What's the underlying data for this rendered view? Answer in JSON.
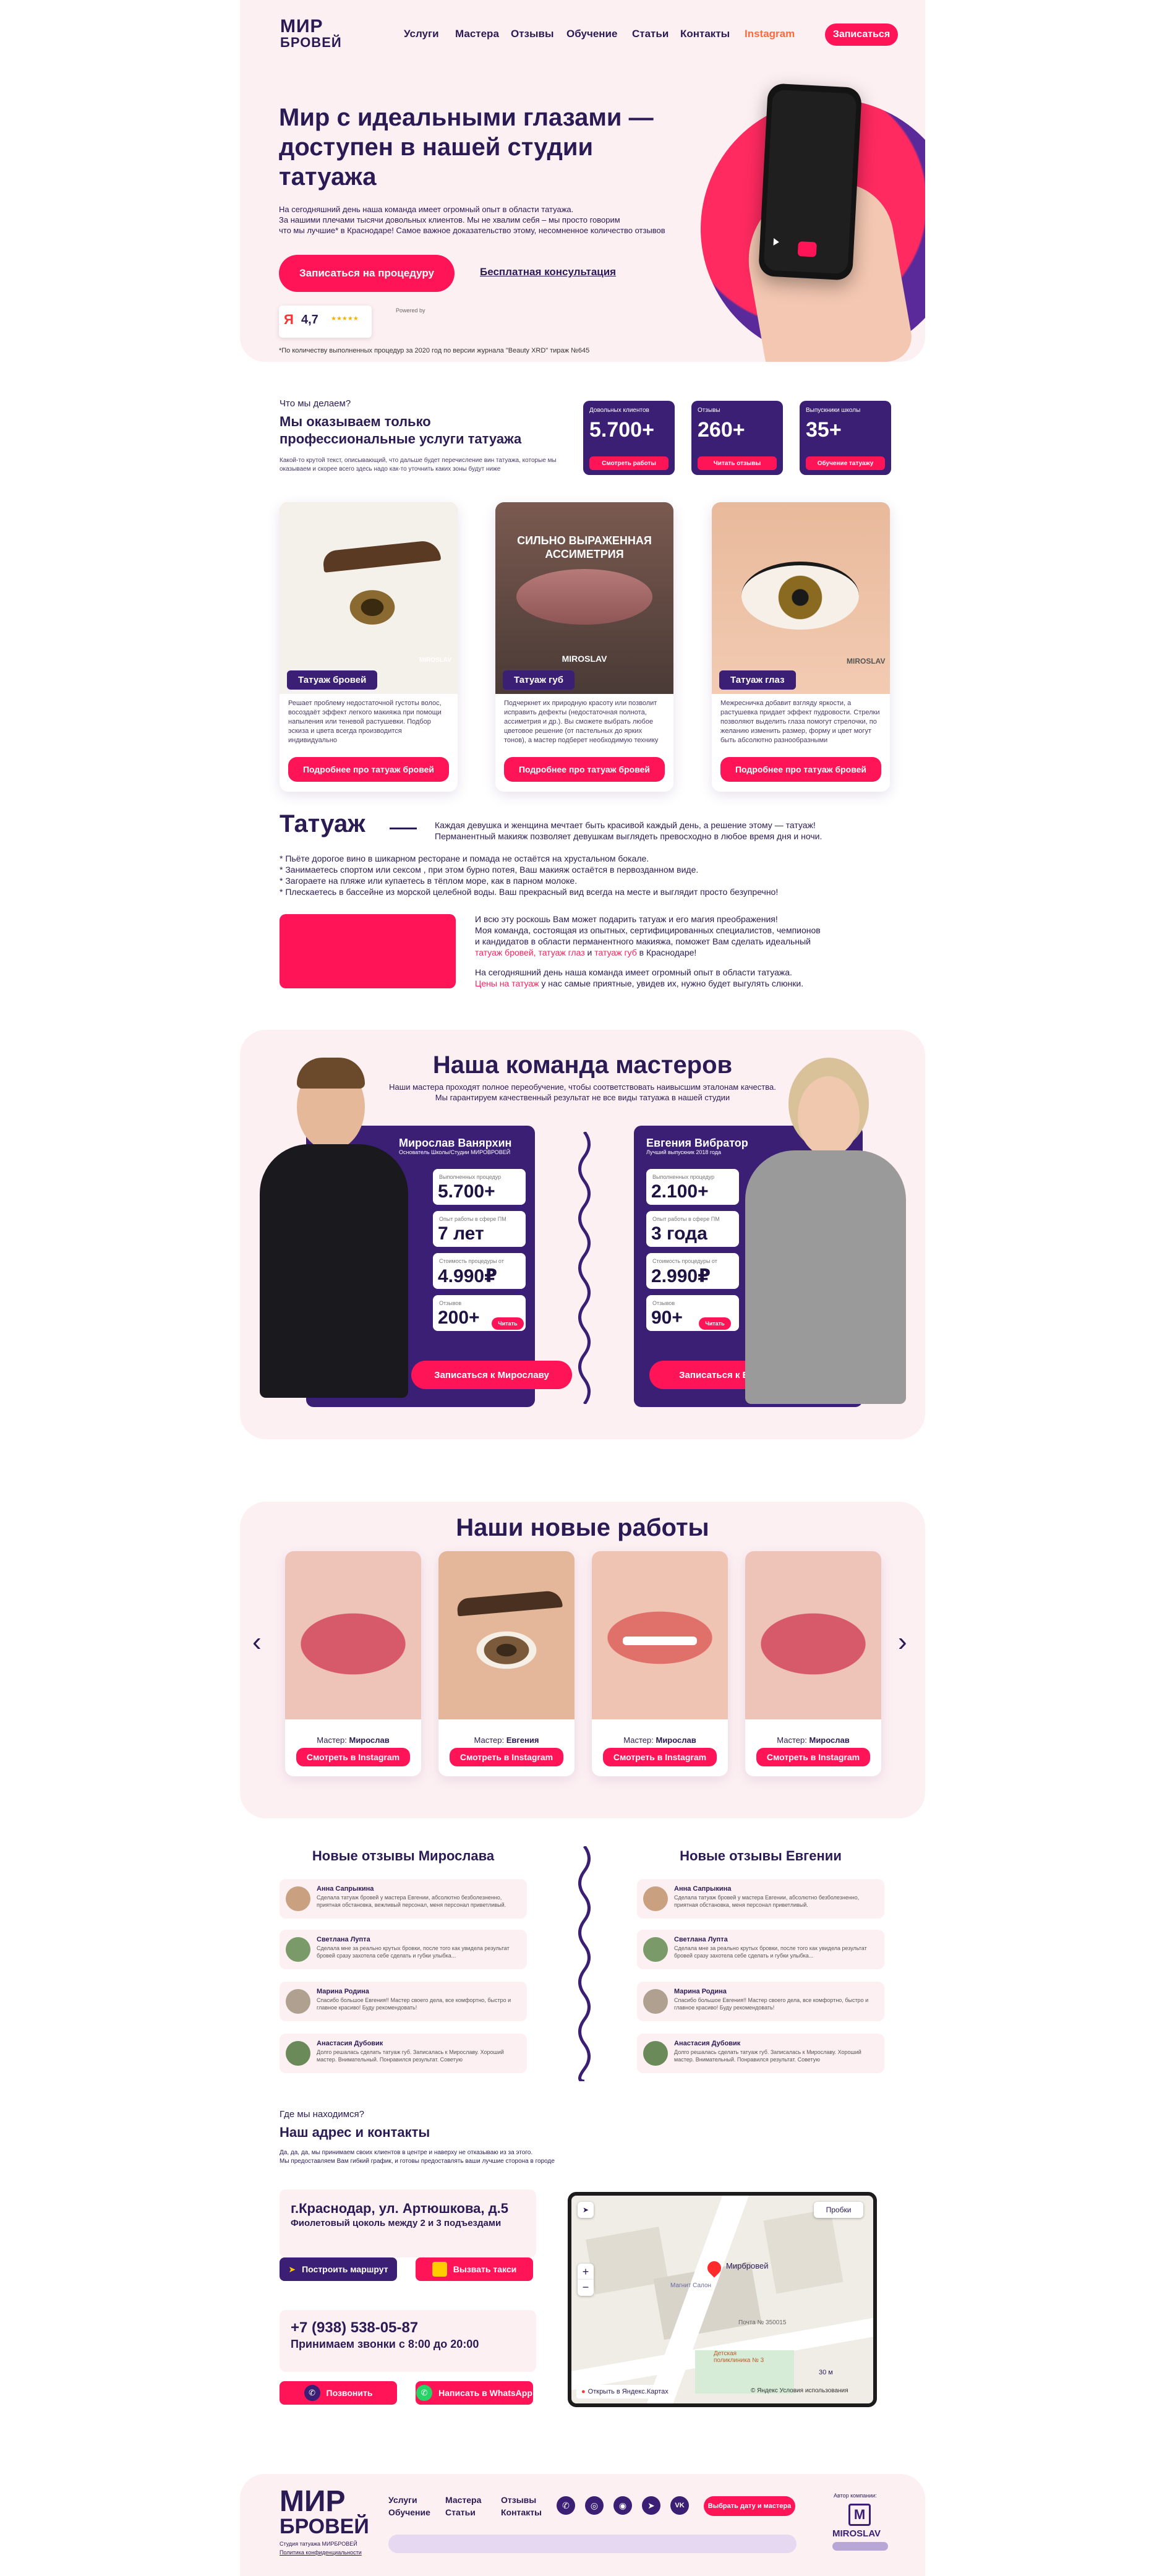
{
  "header": {
    "logo_line1": "МИР",
    "logo_line2": "БРОВЕЙ",
    "nav": [
      "Услуги",
      "Мастера",
      "Отзывы",
      "Обучение",
      "Статьи",
      "Контакты"
    ],
    "instagram": "Instagram",
    "signup_button": "Записаться"
  },
  "hero": {
    "title": "Мир с идеальными глазами — доступен в нашей студии татуажа",
    "text1": "На сегодняшний день наша команда имеет огромный опыт в области татуажа.",
    "text2": "За нашими плечами тысячи довольных клиентов. Мы не хвалим себя – мы просто говорим",
    "text3": "что мы лучшие* в Краснодаре! Самое важное доказательство этому, несомненное количество отзывов",
    "cta": "Записаться на процедуру",
    "consult": "Бесплатная консультация",
    "rating": "4,7",
    "powered": "Powered by",
    "footnote": "*По количеству выполненных процедур за 2020 год по версии журнала \"Beauty XRD\" тираж №645"
  },
  "services_intro": {
    "kicker": "Что мы делаем?",
    "title": "Мы оказываем только профессиональные услуги татуажа",
    "text": "Какой-то крутой текст, описывающий, что дальше будет перечисление вин татуажа, которые мы оказываем и скорее всего здесь надо как-то уточнить каких зоны будут ниже"
  },
  "stats": [
    {
      "label": "Довольных клиентов",
      "value": "5.700+",
      "button": "Смотреть работы"
    },
    {
      "label": "Отзывы",
      "value": "260+",
      "button": "Читать отзывы"
    },
    {
      "label": "Выпускники школы",
      "value": "35+",
      "button": "Обучение татуажу"
    }
  ],
  "services": [
    {
      "tag": "Татуаж бровей",
      "text": "Решает проблему недостаточной густоты волос, восоздаёт эффект легкого макияжа при помощи напыления или теневой растушевки. Подбор эскиза и цвета всегда производится индивидуально",
      "button": "Подробнее про татуаж бровей"
    },
    {
      "tag": "Татуаж губ",
      "text": "Подчеркнет их природную красоту или позволит исправить дефекты (недостаточная полнота, ассиметрия и др.). Вы сможете выбрать любое цветовое решение (от пастельных до ярких тонов), а мастер подберет необходимую технику",
      "button": "Подробнее про татуаж бровей",
      "overlay1": "СИЛЬНО ВЫРАЖЕННАЯ",
      "overlay2": "АССИМЕТРИЯ"
    },
    {
      "tag": "Татуаж глаз",
      "text": "Межресничка добавит взгляду яркости, а растушевка придает эффект пудровости. Стрелки позволяют выделить глаза помогут стрелочки, по желанию изменить размер, форму и цвет могут быть абсолютно разнообразными",
      "button": "Подробнее про татуаж бровей"
    }
  ],
  "watermark": "MIROSLAV",
  "tattoo": {
    "title": "Татуаж",
    "lead1": "Каждая девушка и женщина мечтает быть красивой каждый день, а решение этому — татуаж!",
    "lead2": "Перманентный макияж позволяет девушкам выглядеть превосходно в любое время дня и ночи.",
    "bullets": [
      "* Пьёте дорогое вино в шикарном ресторане и помада не остаётся на хрустальном бокале.",
      "* Занимаетесь спортом или сексом , при этом бурно потея, Ваш макияж остаётся в первозданном виде.",
      "* Загораете на пляже или купаетесь в тёплом море, как в парном молоке.",
      "* Плескаетесь в бассейне из морской целебной воды. Ваш прекрасный вид всегда на месте и выглядит просто безупречно!"
    ],
    "p1a": "И всю эту роскошь Вам может подарить татуаж и его магия преображения!",
    "p1b": "Моя команда, состоящая из опытных, сертифицированных специалистов, чемпионов",
    "p1c": "и кандидатов в области перманентного макияжа, поможет Вам сделать идеальный",
    "p1d_link": "татуаж бровей, татуаж глаз",
    "p1d_mid": " и ",
    "p1d_link2": "татуаж губ",
    "p1d_end": " в Краснодаре!",
    "p2a": "На сегодняшний день наша команда имеет огромный опыт в области татуажа.",
    "p2b_link": "Цены на татуаж",
    "p2b_end": " у нас самые приятные, увидев их, нужно будет выгулять слюнки."
  },
  "team": {
    "title": "Наша команда мастеров",
    "sub1": "Наши мастера проходят полное переобучение, чтобы соответствовать наивысшим эталонам качества.",
    "sub2": "Мы гарантируем качественный результат не все виды татуажа в нашей студии",
    "masters": [
      {
        "name": "Мирослав Ванярхин",
        "role": "Основатель Школы/Студии МИРОВРОВЕЙ",
        "stats": [
          {
            "l": "Выполненных процедур",
            "v": "5.700+"
          },
          {
            "l": "Опыт работы в сфере ПМ",
            "v": "7 лет"
          },
          {
            "l": "Стоимость процедуры от",
            "v": "4.990₽"
          },
          {
            "l": "Отзывов",
            "v": "200+"
          }
        ],
        "read": "Читать",
        "button": "Записаться к Мирославу"
      },
      {
        "name": "Евгения Вибратор",
        "role": "Лучший выпускник 2018 года",
        "stats": [
          {
            "l": "Выполненных процедур",
            "v": "2.100+"
          },
          {
            "l": "Опыт работы в сфере ПМ",
            "v": "3 года"
          },
          {
            "l": "Стоимость процедуры от",
            "v": "2.990₽"
          },
          {
            "l": "Отзывов",
            "v": "90+"
          }
        ],
        "read": "Читать",
        "button": "Записаться к Евгении"
      }
    ]
  },
  "works": {
    "title": "Наши новые работы",
    "items": [
      {
        "master_label": "Мастер:",
        "master": "Мирослав",
        "button": "Смотреть в Instagram"
      },
      {
        "master_label": "Мастер:",
        "master": "Евгения",
        "button": "Смотреть в Instagram"
      },
      {
        "master_label": "Мастер:",
        "master": "Мирослав",
        "button": "Смотреть в Instagram"
      },
      {
        "master_label": "Мастер:",
        "master": "Мирослав",
        "button": "Смотреть в Instagram"
      }
    ]
  },
  "reviews": {
    "left_title": "Новые отзывы Мирослава",
    "right_title": "Новые отзывы Евгении",
    "left": [
      {
        "name": "Анна Сапрыкина",
        "text": "Сделала татуаж бровей у мастера Евгении, абсолютно безболезненно, приятная обстановка, вежливый персонал, меня персонал приветливый."
      },
      {
        "name": "Светлана Лупта",
        "text": "Сделала мне за реально крутых бровки, после того как увидела результат бровей сразу захотела себе сделать и губки улыбка..."
      },
      {
        "name": "Марина Родина",
        "text": "Спасибо большое Евгения!! Мастер своего дела, все комфортно, быстро и главное красиво! Буду рекомендовать!"
      },
      {
        "name": "Анастасия Дубовик",
        "text": "Долго решалась сделать татуаж губ. Записалась к Мирославу. Хороший мастер. Внимательный. Понравился результат. Советую"
      }
    ],
    "right": [
      {
        "name": "Анна Сапрыкина",
        "text": "Сделала татуаж бровей у мастера Евгении, абсолютно безболезненно, приятная обстановка, меня персонал приветливый."
      },
      {
        "name": "Светлана Лупта",
        "text": "Сделала мне за реально крутых бровки, после того как увидела результат бровей сразу захотела себе сделать и губки улыбка..."
      },
      {
        "name": "Марина Родина",
        "text": "Спасибо большое Евгения!! Мастер своего дела, все комфортно, быстро и главное красиво! Буду рекомендовать!"
      },
      {
        "name": "Анастасия Дубовик",
        "text": "Долго решалась сделать татуаж губ. Записалась к Мирославу. Хороший мастер. Внимательный. Понравился результат. Советую"
      }
    ]
  },
  "contacts": {
    "kicker": "Где мы находимся?",
    "title": "Наш адрес и контакты",
    "text1": "Да, да, да, мы принимаем своих клиентов в центре и наверху не отказываю из за этого.",
    "text2": "Мы предоставляем Вам гибкий график, и готовы предоставлять ваши лучшие сторона в городе",
    "address": "г.Краснодар, ул. Артюшкова, д.5",
    "address_sub": "Фиолетовый цоколь между 2 и 3 подъездами",
    "route": "Построить маршрут",
    "taxi": "Вызвать такси",
    "phone": "+7 (938) 538-05-87",
    "hours": "Принимаем звонки с 8:00 до 20:00",
    "call": "Позвонить",
    "whatsapp": "Написать в WhatsApp",
    "map": {
      "traffic": "Пробки",
      "place": "Мирбровей",
      "label1": "Магнит Салон",
      "label2": "Почта № 350015",
      "label3": "Детская поликлиника № 3",
      "open": "Открыть в Яндекс.Картах",
      "copy": "© Яндекс Условия использования",
      "scale": "30 м"
    }
  },
  "footer": {
    "logo_line1": "МИР",
    "logo_line2": "БРОВЕЙ",
    "tagline": "Студия татуажа МИРБРОВЕЙ",
    "policy": "Политика конфиденциальности",
    "col1": [
      "Услуги",
      "Обучение"
    ],
    "col2": [
      "Мастера",
      "Статьи"
    ],
    "col3": [
      "Отзывы",
      "Контакты"
    ],
    "cta": "Выбрать дату и мастера",
    "author_label": "Автор компании:",
    "brand": "MIROSLAV"
  }
}
